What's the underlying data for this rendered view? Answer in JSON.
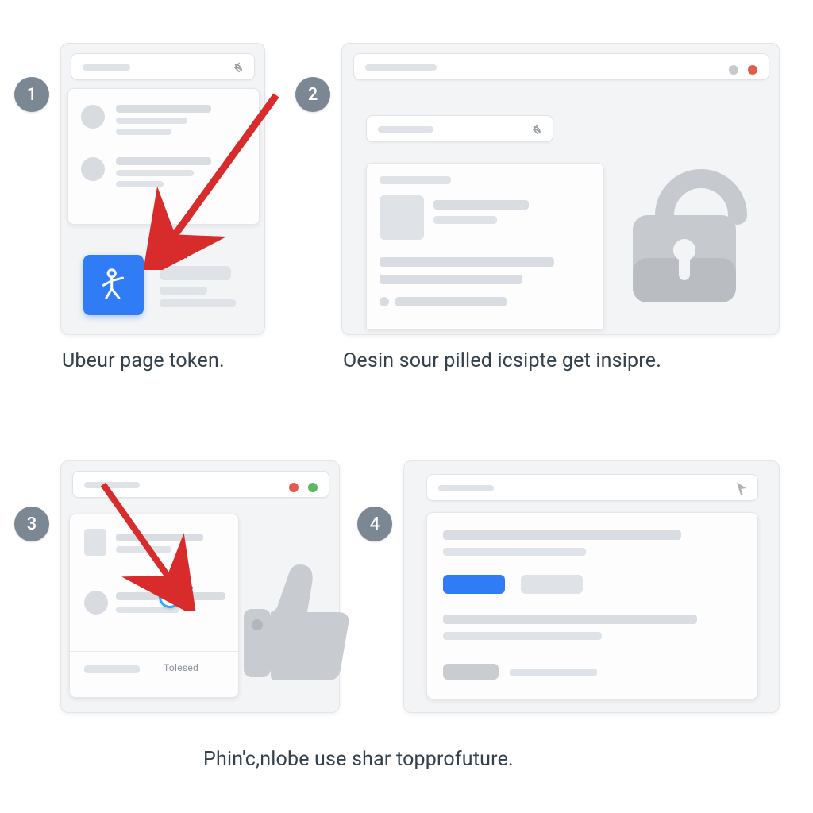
{
  "steps": {
    "s1": {
      "num": "1",
      "caption": "Ubeur page token."
    },
    "s2": {
      "num": "2",
      "caption": "Oesin sour pilled icsipte get insipre."
    },
    "s3": {
      "num": "3",
      "caption_label": "Tolesed"
    },
    "s4": {
      "num": "4"
    }
  },
  "bottom_caption": "Phin'c,nlobe use shar topprofuture.",
  "colors": {
    "accent_blue": "#2f7cf6",
    "arrow_red": "#d82b2b",
    "dot_red": "#e25b4d",
    "dot_green": "#5fb760",
    "dot_grey": "#c7c9cc"
  },
  "icons": {
    "share_arrow": "share-arrow-icon",
    "lock_open": "open-lock-icon",
    "thumbs_up": "thumbs-up-icon",
    "person": "person-icon",
    "pointer": "pointer-arrow-icon",
    "cursor": "cursor-icon"
  }
}
